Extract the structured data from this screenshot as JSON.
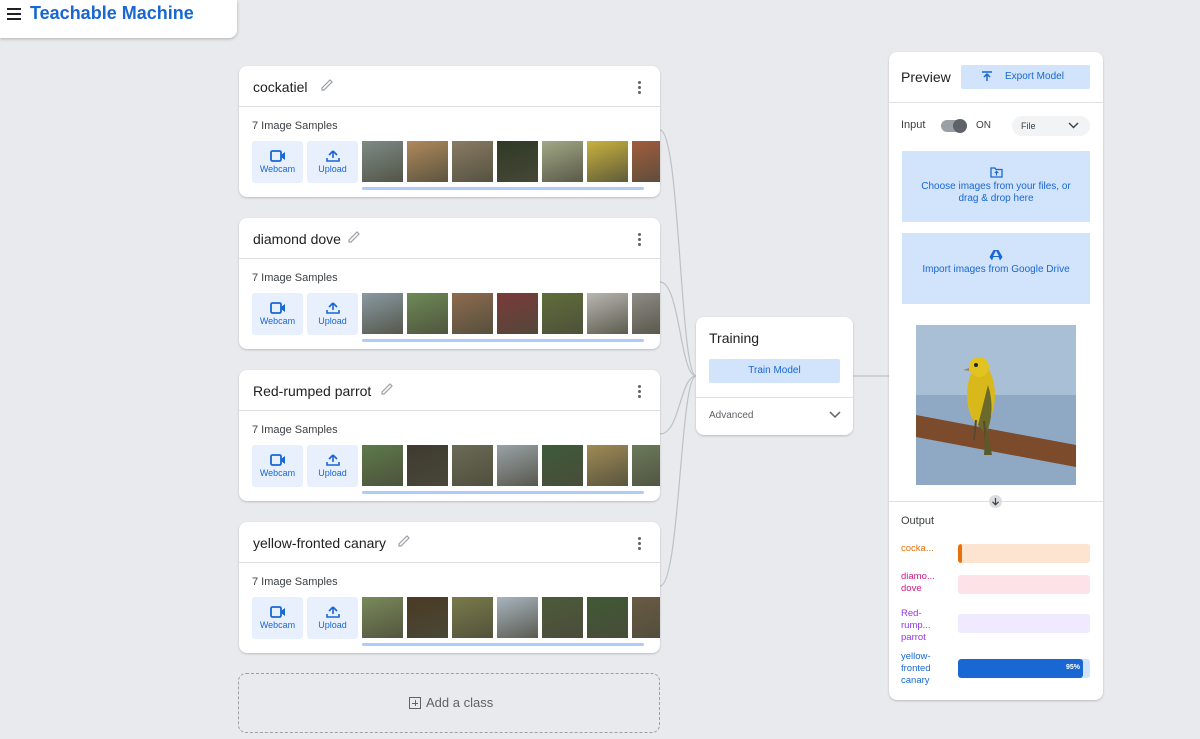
{
  "app": {
    "title": "Teachable Machine"
  },
  "classes": [
    {
      "name": "cockatiel",
      "sample_count": "7 Image Samples",
      "webcam_label": "Webcam",
      "upload_label": "Upload",
      "thumb_colors": [
        "#7d8b86",
        "#b0895b",
        "#8a7b63",
        "#2f3a25",
        "#a2a887",
        "#c9b23c",
        "#a15c3e"
      ]
    },
    {
      "name": "diamond dove",
      "sample_count": "7 Image Samples",
      "webcam_label": "Webcam",
      "upload_label": "Upload",
      "thumb_colors": [
        "#8a9aa2",
        "#6d8a56",
        "#8e6b4f",
        "#7b3a3a",
        "#5f6e3a",
        "#b9b6b2",
        "#8f8a86"
      ]
    },
    {
      "name": "Red-rumped parrot",
      "sample_count": "7 Image Samples",
      "webcam_label": "Webcam",
      "upload_label": "Upload",
      "thumb_colors": [
        "#5d7a4a",
        "#3f3a30",
        "#6b6a55",
        "#9aa2a8",
        "#3e5a3a",
        "#a08a55",
        "#6b7a5a"
      ]
    },
    {
      "name": "yellow-fronted canary",
      "sample_count": "7 Image Samples",
      "webcam_label": "Webcam",
      "upload_label": "Upload",
      "thumb_colors": [
        "#7a8a5a",
        "#4a3a24",
        "#7a7a4a",
        "#a9b4c0",
        "#4d5a3a",
        "#3f5a34",
        "#6a5a44"
      ]
    }
  ],
  "add_class": {
    "label": "Add a class"
  },
  "training": {
    "title": "Training",
    "train_button": "Train Model",
    "advanced_label": "Advanced"
  },
  "preview": {
    "title": "Preview",
    "export_button": "Export Model",
    "input_label": "Input",
    "toggle_state": "ON",
    "source_select": "File",
    "file_drop_text": "Choose images from your files, or drag & drop here",
    "drive_import_text": "Import images from Google Drive",
    "output_title": "Output",
    "outputs": [
      {
        "label": "cocka...",
        "confidence": 0.03,
        "color": "#e8710a",
        "track": "#fde4d0",
        "pct_text": ""
      },
      {
        "label": "diamo... dove",
        "confidence": 0.0,
        "color": "#d01884",
        "track": "#fde3e7",
        "pct_text": ""
      },
      {
        "label": "Red- rump... parrot",
        "confidence": 0.0,
        "color": "#9334e6",
        "track": "#efeafd",
        "pct_text": ""
      },
      {
        "label": "yellow- fronted canary",
        "confidence": 0.95,
        "color": "#1967d2",
        "track": "#d2e3fc",
        "pct_text": "95%"
      }
    ]
  }
}
